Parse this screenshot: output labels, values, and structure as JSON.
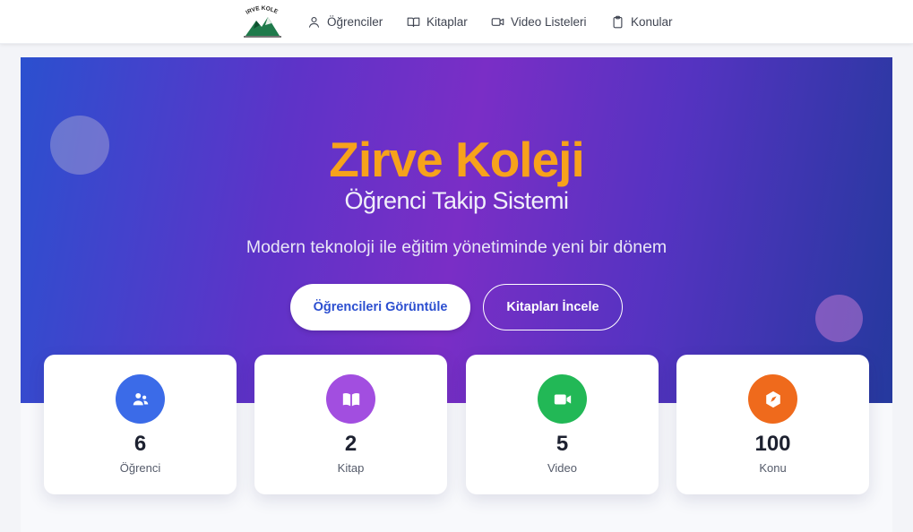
{
  "nav": {
    "logo_text": "ZIRVE KOLEJI",
    "items": [
      {
        "label": "Öğrenciler",
        "icon": "user-icon"
      },
      {
        "label": "Kitaplar",
        "icon": "book-icon"
      },
      {
        "label": "Video Listeleri",
        "icon": "video-icon"
      },
      {
        "label": "Konular",
        "icon": "clipboard-icon"
      }
    ]
  },
  "hero": {
    "title": "Zirve Koleji",
    "subtitle": "Öğrenci Takip Sistemi",
    "description": "Modern teknoloji ile eğitim yönetiminde yeni bir dönem",
    "primary_button": "Öğrencileri Görüntüle",
    "secondary_button": "Kitapları İncele"
  },
  "stats": [
    {
      "value": "6",
      "label": "Öğrenci",
      "icon": "users-icon",
      "color": "#3b6be8"
    },
    {
      "value": "2",
      "label": "Kitap",
      "icon": "book-open-icon",
      "color": "#a24ee0"
    },
    {
      "value": "5",
      "label": "Video",
      "icon": "video-camera-icon",
      "color": "#22b856"
    },
    {
      "value": "100",
      "label": "Konu",
      "icon": "compass-icon",
      "color": "#ef6a1c"
    }
  ],
  "colors": {
    "accent": "#f7a21b",
    "hero_gradient": [
      "#2b50cf",
      "#7a2ec6",
      "#25399e"
    ],
    "primary_text": "#2c4fd0"
  }
}
